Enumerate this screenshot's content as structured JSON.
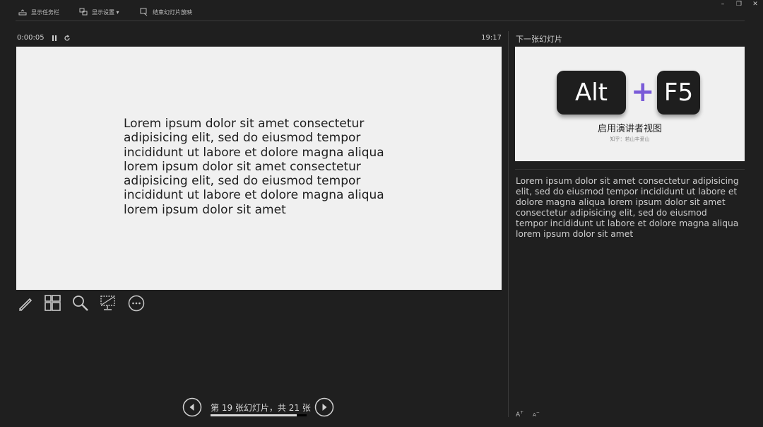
{
  "toolbar": {
    "taskbar_label": "显示任务栏",
    "settings_label": "显示设置 ▾",
    "end_label": "结束幻灯片放映"
  },
  "window": {
    "minimize": "–",
    "restore": "❐",
    "close": "✕"
  },
  "presenter": {
    "elapsed_time": "0:00:05",
    "clock": "19:17"
  },
  "current_slide": {
    "lines": [
      "Lorem ipsum dolor sit amet consectetur",
      "adipisicing elit, sed do eiusmod tempor",
      "incididunt ut labore et dolore magna aliqua",
      "lorem ipsum dolor sit amet consectetur",
      "adipisicing elit, sed do eiusmod tempor",
      "incididunt ut labore et dolore magna aliqua",
      "lorem ipsum dolor sit amet"
    ]
  },
  "next_slide": {
    "label": "下一张幻灯片",
    "key_alt": "Alt",
    "plus": "+",
    "key_f5": "F5",
    "title": "启用演讲者视图",
    "credit": "知乎：若山丰爱山",
    "accent_color": "#7a5bd8"
  },
  "notes": {
    "text": "Lorem ipsum dolor sit amet consectetur adipisicing elit, sed do eiusmod tempor incididunt ut labore et dolore magna aliqua lorem ipsum dolor sit amet consectetur adipisicing elit, sed do eiusmod tempor incididunt ut labore et dolore magna aliqua lorem ipsum dolor sit amet",
    "font_up": "A",
    "font_down": "A"
  },
  "navigation": {
    "counter": "第 19 张幻灯片，共 21 张",
    "current": 19,
    "total": 21,
    "progress": 0.9
  },
  "tools": [
    "pen-icon",
    "slides-grid-icon",
    "zoom-icon",
    "screen-icon",
    "more-icon"
  ]
}
